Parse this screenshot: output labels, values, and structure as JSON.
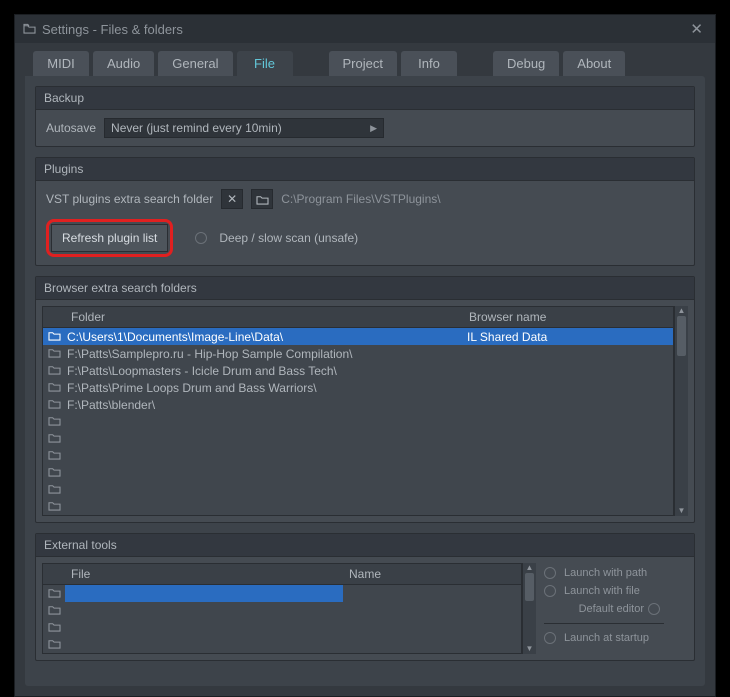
{
  "window": {
    "title": "Settings - Files & folders"
  },
  "tabs": {
    "midi": "MIDI",
    "audio": "Audio",
    "general": "General",
    "file": "File",
    "project": "Project",
    "info": "Info",
    "debug": "Debug",
    "about": "About",
    "active": "file"
  },
  "backup": {
    "group_title": "Backup",
    "autosave_label": "Autosave",
    "autosave_value": "Never (just remind every 10min)"
  },
  "plugins": {
    "group_title": "Plugins",
    "search_label": "VST plugins extra search folder",
    "path": "C:\\Program Files\\VSTPlugins\\",
    "refresh_label": "Refresh plugin list",
    "deepscan_label": "Deep / slow scan (unsafe)"
  },
  "browser": {
    "group_title": "Browser extra search folders",
    "col_folder": "Folder",
    "col_bname": "Browser name",
    "rows": [
      {
        "folder": "C:\\Users\\1\\Documents\\Image-Line\\Data\\",
        "bname": "IL Shared Data",
        "selected": true
      },
      {
        "folder": "F:\\Patts\\Samplepro.ru - Hip-Hop Sample Compilation\\",
        "bname": ""
      },
      {
        "folder": "F:\\Patts\\Loopmasters - Icicle Drum and Bass Tech\\",
        "bname": ""
      },
      {
        "folder": "F:\\Patts\\Prime Loops Drum and Bass Warriors\\",
        "bname": ""
      },
      {
        "folder": "F:\\Patts\\blender\\",
        "bname": ""
      },
      {
        "folder": "",
        "bname": ""
      },
      {
        "folder": "",
        "bname": ""
      },
      {
        "folder": "",
        "bname": ""
      },
      {
        "folder": "",
        "bname": ""
      },
      {
        "folder": "",
        "bname": ""
      },
      {
        "folder": "",
        "bname": ""
      }
    ]
  },
  "external": {
    "group_title": "External tools",
    "col_file": "File",
    "col_name": "Name",
    "rows": [
      {
        "file": "",
        "name": "",
        "selected": true
      },
      {
        "file": "",
        "name": ""
      },
      {
        "file": "",
        "name": ""
      },
      {
        "file": "",
        "name": ""
      }
    ],
    "opt_launch_path": "Launch with path",
    "opt_launch_file": "Launch with file",
    "opt_default_editor": "Default editor",
    "opt_launch_startup": "Launch at startup"
  }
}
